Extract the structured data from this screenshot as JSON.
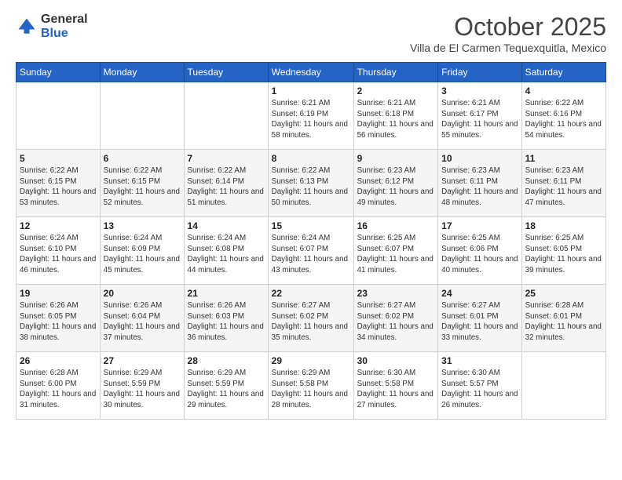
{
  "logo": {
    "general": "General",
    "blue": "Blue"
  },
  "header": {
    "month": "October 2025",
    "location": "Villa de El Carmen Tequexquitla, Mexico"
  },
  "days_of_week": [
    "Sunday",
    "Monday",
    "Tuesday",
    "Wednesday",
    "Thursday",
    "Friday",
    "Saturday"
  ],
  "weeks": [
    [
      {
        "day": "",
        "info": ""
      },
      {
        "day": "",
        "info": ""
      },
      {
        "day": "",
        "info": ""
      },
      {
        "day": "1",
        "info": "Sunrise: 6:21 AM\nSunset: 6:19 PM\nDaylight: 11 hours and 58 minutes."
      },
      {
        "day": "2",
        "info": "Sunrise: 6:21 AM\nSunset: 6:18 PM\nDaylight: 11 hours and 56 minutes."
      },
      {
        "day": "3",
        "info": "Sunrise: 6:21 AM\nSunset: 6:17 PM\nDaylight: 11 hours and 55 minutes."
      },
      {
        "day": "4",
        "info": "Sunrise: 6:22 AM\nSunset: 6:16 PM\nDaylight: 11 hours and 54 minutes."
      }
    ],
    [
      {
        "day": "5",
        "info": "Sunrise: 6:22 AM\nSunset: 6:15 PM\nDaylight: 11 hours and 53 minutes."
      },
      {
        "day": "6",
        "info": "Sunrise: 6:22 AM\nSunset: 6:15 PM\nDaylight: 11 hours and 52 minutes."
      },
      {
        "day": "7",
        "info": "Sunrise: 6:22 AM\nSunset: 6:14 PM\nDaylight: 11 hours and 51 minutes."
      },
      {
        "day": "8",
        "info": "Sunrise: 6:22 AM\nSunset: 6:13 PM\nDaylight: 11 hours and 50 minutes."
      },
      {
        "day": "9",
        "info": "Sunrise: 6:23 AM\nSunset: 6:12 PM\nDaylight: 11 hours and 49 minutes."
      },
      {
        "day": "10",
        "info": "Sunrise: 6:23 AM\nSunset: 6:11 PM\nDaylight: 11 hours and 48 minutes."
      },
      {
        "day": "11",
        "info": "Sunrise: 6:23 AM\nSunset: 6:11 PM\nDaylight: 11 hours and 47 minutes."
      }
    ],
    [
      {
        "day": "12",
        "info": "Sunrise: 6:24 AM\nSunset: 6:10 PM\nDaylight: 11 hours and 46 minutes."
      },
      {
        "day": "13",
        "info": "Sunrise: 6:24 AM\nSunset: 6:09 PM\nDaylight: 11 hours and 45 minutes."
      },
      {
        "day": "14",
        "info": "Sunrise: 6:24 AM\nSunset: 6:08 PM\nDaylight: 11 hours and 44 minutes."
      },
      {
        "day": "15",
        "info": "Sunrise: 6:24 AM\nSunset: 6:07 PM\nDaylight: 11 hours and 43 minutes."
      },
      {
        "day": "16",
        "info": "Sunrise: 6:25 AM\nSunset: 6:07 PM\nDaylight: 11 hours and 41 minutes."
      },
      {
        "day": "17",
        "info": "Sunrise: 6:25 AM\nSunset: 6:06 PM\nDaylight: 11 hours and 40 minutes."
      },
      {
        "day": "18",
        "info": "Sunrise: 6:25 AM\nSunset: 6:05 PM\nDaylight: 11 hours and 39 minutes."
      }
    ],
    [
      {
        "day": "19",
        "info": "Sunrise: 6:26 AM\nSunset: 6:05 PM\nDaylight: 11 hours and 38 minutes."
      },
      {
        "day": "20",
        "info": "Sunrise: 6:26 AM\nSunset: 6:04 PM\nDaylight: 11 hours and 37 minutes."
      },
      {
        "day": "21",
        "info": "Sunrise: 6:26 AM\nSunset: 6:03 PM\nDaylight: 11 hours and 36 minutes."
      },
      {
        "day": "22",
        "info": "Sunrise: 6:27 AM\nSunset: 6:02 PM\nDaylight: 11 hours and 35 minutes."
      },
      {
        "day": "23",
        "info": "Sunrise: 6:27 AM\nSunset: 6:02 PM\nDaylight: 11 hours and 34 minutes."
      },
      {
        "day": "24",
        "info": "Sunrise: 6:27 AM\nSunset: 6:01 PM\nDaylight: 11 hours and 33 minutes."
      },
      {
        "day": "25",
        "info": "Sunrise: 6:28 AM\nSunset: 6:01 PM\nDaylight: 11 hours and 32 minutes."
      }
    ],
    [
      {
        "day": "26",
        "info": "Sunrise: 6:28 AM\nSunset: 6:00 PM\nDaylight: 11 hours and 31 minutes."
      },
      {
        "day": "27",
        "info": "Sunrise: 6:29 AM\nSunset: 5:59 PM\nDaylight: 11 hours and 30 minutes."
      },
      {
        "day": "28",
        "info": "Sunrise: 6:29 AM\nSunset: 5:59 PM\nDaylight: 11 hours and 29 minutes."
      },
      {
        "day": "29",
        "info": "Sunrise: 6:29 AM\nSunset: 5:58 PM\nDaylight: 11 hours and 28 minutes."
      },
      {
        "day": "30",
        "info": "Sunrise: 6:30 AM\nSunset: 5:58 PM\nDaylight: 11 hours and 27 minutes."
      },
      {
        "day": "31",
        "info": "Sunrise: 6:30 AM\nSunset: 5:57 PM\nDaylight: 11 hours and 26 minutes."
      },
      {
        "day": "",
        "info": ""
      }
    ]
  ]
}
